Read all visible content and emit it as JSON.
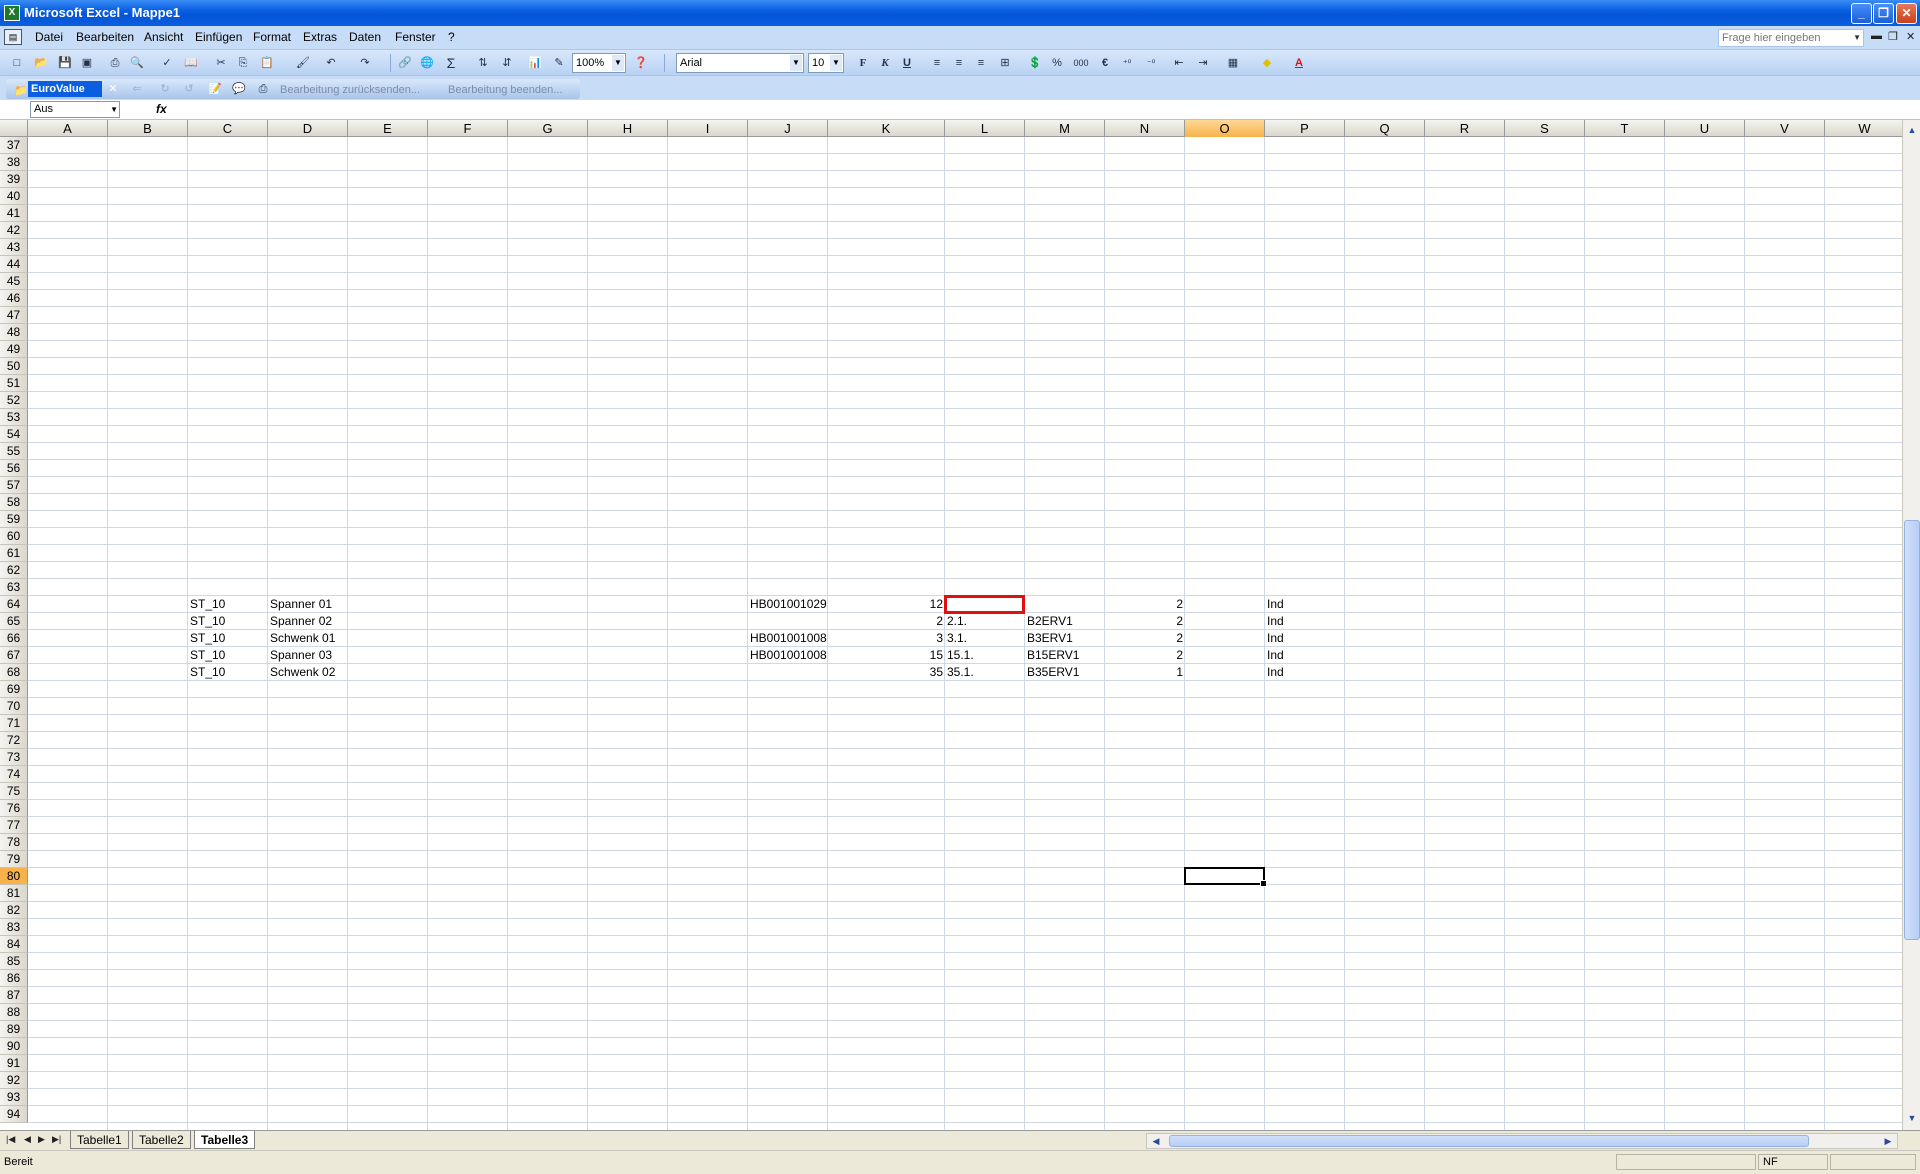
{
  "window": {
    "title": "Microsoft Excel - Mappe1"
  },
  "menu": {
    "items": [
      "Datei",
      "Bearbeiten",
      "Ansicht",
      "Einfügen",
      "Format",
      "Extras",
      "Daten",
      "Fenster",
      "?"
    ],
    "help_placeholder": "Frage hier eingeben"
  },
  "toolbar": {
    "zoom": "100%",
    "font": "Arial",
    "size": "10",
    "bold": "F",
    "italic": "K",
    "underline": "U",
    "percent": "%",
    "thousands": "000",
    "euro": "€",
    "autosum": "Σ"
  },
  "toolbar2": {
    "eurovalue": "EuroValue",
    "send_back": "Bearbeitung zurücksenden...",
    "end_edit": "Bearbeitung beenden..."
  },
  "formula": {
    "namebox": "Aus",
    "fx": "fx",
    "content": ""
  },
  "columns": [
    "A",
    "B",
    "C",
    "D",
    "E",
    "F",
    "G",
    "H",
    "I",
    "J",
    "K",
    "L",
    "M",
    "N",
    "O",
    "P",
    "Q",
    "R",
    "S",
    "T",
    "U",
    "V",
    "W"
  ],
  "selected_column": "O",
  "rows": {
    "first": 37,
    "last": 94,
    "selected": 80
  },
  "cells": [
    {
      "row": 64,
      "col": "C",
      "value": "ST_10"
    },
    {
      "row": 64,
      "col": "D",
      "value": "Spanner 01"
    },
    {
      "row": 64,
      "col": "J",
      "value": "HB001001029"
    },
    {
      "row": 64,
      "col": "K",
      "value": "12"
    },
    {
      "row": 64,
      "col": "N",
      "value": "2"
    },
    {
      "row": 64,
      "col": "P",
      "value": "Ind"
    },
    {
      "row": 65,
      "col": "C",
      "value": "ST_10"
    },
    {
      "row": 65,
      "col": "D",
      "value": "Spanner 02"
    },
    {
      "row": 65,
      "col": "K",
      "value": "2"
    },
    {
      "row": 65,
      "col": "L",
      "value": "2.1."
    },
    {
      "row": 65,
      "col": "M",
      "value": "B2ERV1"
    },
    {
      "row": 65,
      "col": "N",
      "value": "2"
    },
    {
      "row": 65,
      "col": "P",
      "value": "Ind"
    },
    {
      "row": 66,
      "col": "C",
      "value": "ST_10"
    },
    {
      "row": 66,
      "col": "D",
      "value": "Schwenk 01"
    },
    {
      "row": 66,
      "col": "J",
      "value": "HB001001008"
    },
    {
      "row": 66,
      "col": "K",
      "value": "3"
    },
    {
      "row": 66,
      "col": "L",
      "value": "3.1."
    },
    {
      "row": 66,
      "col": "M",
      "value": "B3ERV1"
    },
    {
      "row": 66,
      "col": "N",
      "value": "2"
    },
    {
      "row": 66,
      "col": "P",
      "value": "Ind"
    },
    {
      "row": 67,
      "col": "C",
      "value": "ST_10"
    },
    {
      "row": 67,
      "col": "D",
      "value": "Spanner 03"
    },
    {
      "row": 67,
      "col": "J",
      "value": "HB001001008"
    },
    {
      "row": 67,
      "col": "K",
      "value": "15"
    },
    {
      "row": 67,
      "col": "L",
      "value": "15.1."
    },
    {
      "row": 67,
      "col": "M",
      "value": "B15ERV1"
    },
    {
      "row": 67,
      "col": "N",
      "value": "2"
    },
    {
      "row": 67,
      "col": "P",
      "value": "Ind"
    },
    {
      "row": 68,
      "col": "C",
      "value": "ST_10"
    },
    {
      "row": 68,
      "col": "D",
      "value": "Schwenk 02"
    },
    {
      "row": 68,
      "col": "K",
      "value": "35"
    },
    {
      "row": 68,
      "col": "L",
      "value": "35.1."
    },
    {
      "row": 68,
      "col": "M",
      "value": "B35ERV1"
    },
    {
      "row": 68,
      "col": "N",
      "value": "1"
    },
    {
      "row": 68,
      "col": "P",
      "value": "Ind"
    }
  ],
  "highlight_cell": {
    "row": 64,
    "col": "L",
    "color": "#e01010"
  },
  "active_cell": {
    "row": 80,
    "col": "O"
  },
  "sheets": {
    "tabs": [
      "Tabelle1",
      "Tabelle2",
      "Tabelle3"
    ],
    "active": "Tabelle3"
  },
  "status": {
    "ready": "Bereit",
    "indicator": "NF"
  }
}
